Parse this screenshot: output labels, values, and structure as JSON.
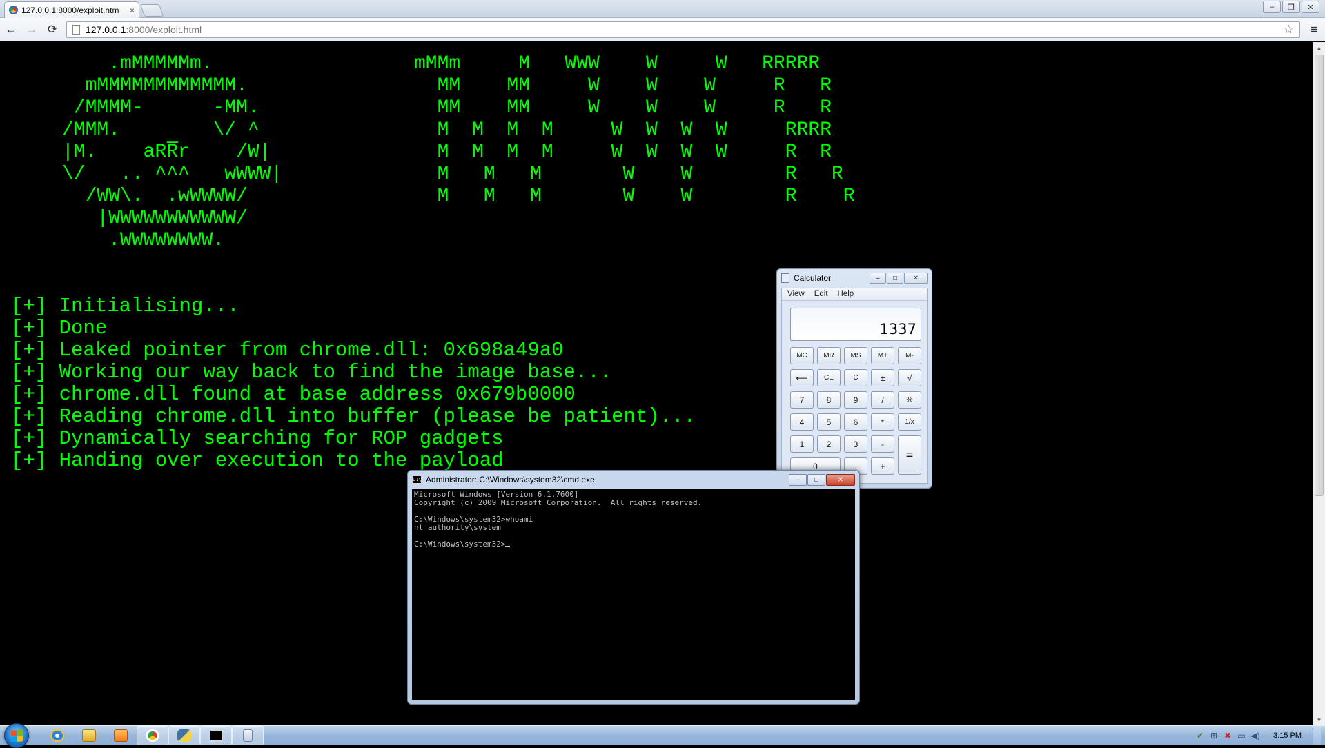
{
  "browser": {
    "tab_title": "127.0.0.1:8000/exploit.htm",
    "tab_close": "×",
    "url_host": "127.0.0.1",
    "url_rest": ":8000/exploit.html",
    "back": "←",
    "forward": "→",
    "reload": "⟳",
    "star": "☆",
    "menu": "≡",
    "win_minimize": "–",
    "win_restore": "❐",
    "win_close": "✕"
  },
  "page": {
    "ascii_logo": "    .mMMMMMm.\n  mMMMMMMMMMMMM.\n /MMMM-      -MM.\n/MMM.        \\/ ^\n|M.    aRR̅r    /W|\n\\/   .. ^^^   wWWW|\n  /WW\\.  .wWWWW/\n   |WWWWWWWWWWW/\n    .WWWWWWWW.",
    "ascii_banner": "mMMm     M   WWW    W     W   RRRRR\n  MM    MM     W    W    W     R   R\n  MM    MM     W    W    W     R   R\n  M  M  M  M     W  W  W  W     RRRR\n  M  M  M  M     W  W  W  W     R  R\n  M   M   M       W    W        R   R\n  M   M   M       W    W        R    R",
    "log": [
      "[+] Initialising...",
      "[+] Done",
      "[+] Leaked pointer from chrome.dll: 0x698a49a0",
      "[+] Working our way back to find the image base...",
      "[+] chrome.dll found at base address 0x679b0000",
      "[+] Reading chrome.dll into buffer (please be patient)...",
      "[+] Dynamically searching for ROP gadgets",
      "[+] Handing over execution to the payload"
    ]
  },
  "calculator": {
    "title": "Calculator",
    "menu": [
      "View",
      "Edit",
      "Help"
    ],
    "display": "1337",
    "keys": {
      "mc": "MC",
      "mr": "MR",
      "ms": "MS",
      "mplus": "M+",
      "mminus": "M-",
      "back": "⟵",
      "ce": "CE",
      "c": "C",
      "pm": "±",
      "sqrt": "√",
      "k7": "7",
      "k8": "8",
      "k9": "9",
      "div": "/",
      "pct": "%",
      "k4": "4",
      "k5": "5",
      "k6": "6",
      "mul": "*",
      "inv": "1/x",
      "k1": "1",
      "k2": "2",
      "k3": "3",
      "sub": "-",
      "eq": "=",
      "k0": "0",
      "dot": ".",
      "add": "+"
    },
    "close": "✕",
    "minimize": "–",
    "maximize": "□"
  },
  "cmd": {
    "title": "Administrator: C:\\Windows\\system32\\cmd.exe",
    "icon_text": "C:\\",
    "lines": [
      "Microsoft Windows [Version 6.1.7600]",
      "Copyright (c) 2009 Microsoft Corporation.  All rights reserved.",
      "",
      "C:\\Windows\\system32>whoami",
      "nt authority\\system",
      ""
    ],
    "prompt": "C:\\Windows\\system32>",
    "minimize": "–",
    "maximize": "□",
    "close": "✕"
  },
  "taskbar": {
    "clock": "3:15 PM",
    "tray_icons": [
      "shield-check-icon",
      "network-icon",
      "flag-icon",
      "display-icon",
      "volume-icon"
    ],
    "tray_glyphs": [
      "✔",
      "⊞",
      "✖",
      "▭",
      "◀)"
    ]
  }
}
